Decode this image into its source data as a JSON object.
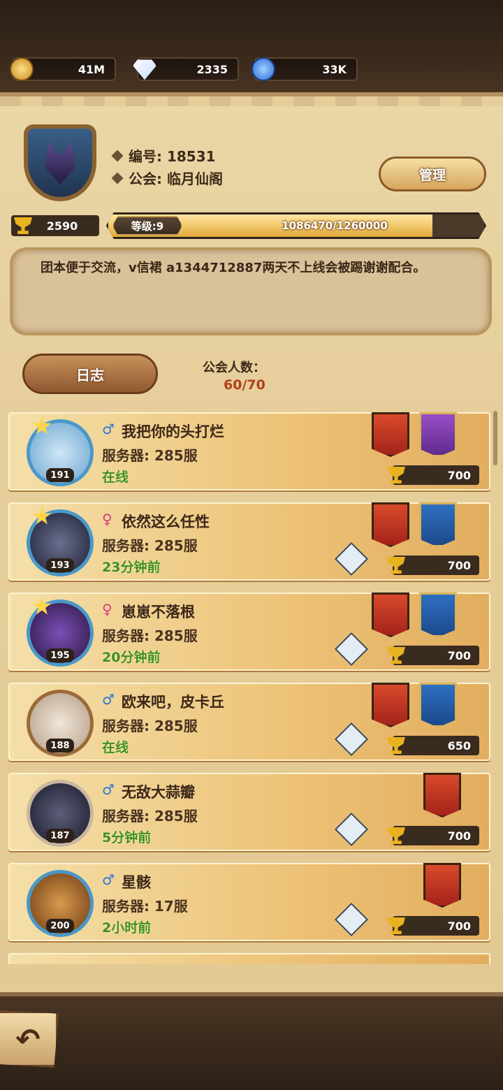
{
  "resources": {
    "gold": "41M",
    "diamonds": "2335",
    "dust": "33K"
  },
  "guild": {
    "id_line": "编号: 18531",
    "name_line": "公会: 临月仙阁",
    "manage_label": "管理",
    "trophies": "2590",
    "level_label": "等级:9",
    "xp_text": "1086470/1260000",
    "xp_progress": 0.862,
    "notice": "团本便于交流，v信裙 a1344712887两天不上线会被踢谢谢配合。",
    "log_label": "日志",
    "member_count_label": "公会人数：",
    "member_count_value": "60/70"
  },
  "members": [
    {
      "gender": "♂",
      "gender_class": "m",
      "name": "我把你的头打烂",
      "server": "服务器: 285服",
      "status": "在线",
      "level": "191",
      "trophy": "700",
      "banners": [
        "red",
        "purple"
      ],
      "star": true,
      "battle": false
    },
    {
      "gender": "♀",
      "gender_class": "f",
      "name": "依然这么任性",
      "server": "服务器: 285服",
      "status": "23分钟前",
      "level": "193",
      "trophy": "700",
      "banners": [
        "red",
        "blue"
      ],
      "star": true,
      "battle": true
    },
    {
      "gender": "♀",
      "gender_class": "f",
      "name": "崽崽不落根",
      "server": "服务器: 285服",
      "status": "20分钟前",
      "level": "195",
      "trophy": "700",
      "banners": [
        "red",
        "blue"
      ],
      "star": true,
      "battle": true
    },
    {
      "gender": "♂",
      "gender_class": "m",
      "name": "欧来吧，皮卡丘",
      "server": "服务器: 285服",
      "status": "在线",
      "level": "188",
      "trophy": "650",
      "banners": [
        "red",
        "blue"
      ],
      "star": false,
      "battle": true
    },
    {
      "gender": "♂",
      "gender_class": "m",
      "name": "无敌大蒜瓣",
      "server": "服务器: 285服",
      "status": "5分钟前",
      "level": "187",
      "trophy": "700",
      "banners": [
        "red"
      ],
      "star": false,
      "battle": true
    },
    {
      "gender": "♂",
      "gender_class": "m",
      "name": "星骸",
      "server": "服务器: 17服",
      "status": "2小时前",
      "level": "200",
      "trophy": "700",
      "banners": [
        "red"
      ],
      "star": false,
      "battle": true
    }
  ]
}
